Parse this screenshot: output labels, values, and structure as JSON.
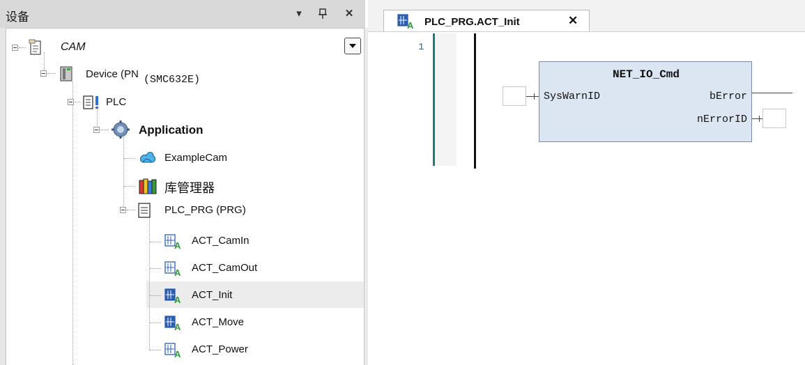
{
  "devices_panel": {
    "title": "设备",
    "header_buttons": [
      {
        "icon": "dropdown-arrow",
        "glyph": "▾"
      },
      {
        "icon": "pin-icon",
        "glyph": "⊥"
      },
      {
        "icon": "close-icon",
        "glyph": "✕"
      }
    ],
    "tree": [
      {
        "label": "CAM",
        "icon": "project-icon"
      },
      {
        "label": "Device (PN",
        "suffix": "(SMC632E)",
        "icon": "device-icon"
      },
      {
        "label": "PLC",
        "icon": "plc-icon"
      },
      {
        "label": "Application",
        "icon": "gear-icon"
      },
      {
        "label": "ExampleCam",
        "icon": "cam-table-icon"
      },
      {
        "label": "库管理器",
        "icon": "library-manager-icon"
      },
      {
        "label": "PLC_PRG (PRG)",
        "icon": "program-icon"
      },
      {
        "label": "ACT_CamIn",
        "icon": "action-icon"
      },
      {
        "label": "ACT_CamOut",
        "icon": "action-icon"
      },
      {
        "label": "ACT_Init",
        "icon": "action-icon",
        "selected": true
      },
      {
        "label": "ACT_Move",
        "icon": "action-icon"
      },
      {
        "label": "ACT_Power",
        "icon": "action-icon"
      }
    ]
  },
  "editor": {
    "tab": {
      "label": "PLC_PRG.ACT_Init",
      "close": "✕",
      "icon": "action-icon"
    },
    "line_number": "1",
    "function_block": {
      "name": "NET_IO_Cmd",
      "inputs": [
        "SysWarnID"
      ],
      "outputs": [
        "bError",
        "nErrorID"
      ]
    }
  },
  "colors": {
    "selection": "#ececec",
    "fb_fill": "#dce6f3",
    "gutter_marker": "#1b7d78"
  }
}
